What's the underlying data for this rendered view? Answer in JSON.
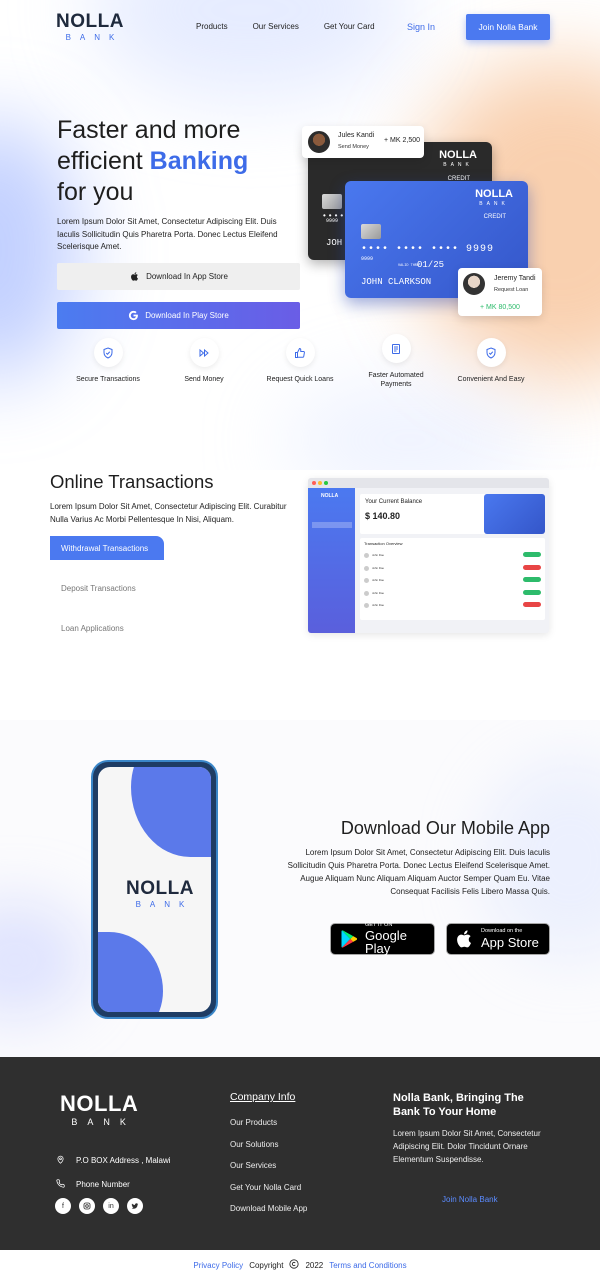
{
  "brand": {
    "name": "NOLLA",
    "sub": "BANK"
  },
  "nav": {
    "links": [
      "Products",
      "Our Services",
      "Get Your Card"
    ],
    "signin": "Sign In",
    "join": "Join Nolla Bank"
  },
  "hero": {
    "title_line1": "Faster and more",
    "title_line2_plain": "efficient ",
    "title_line2_accent": "Banking",
    "title_line3": "for you",
    "description": "Lorem Ipsum Dolor Sit Amet, Consectetur Adipiscing Elit. Duis Iaculis Sollicitudin Quis Pharetra Porta. Donec Lectus Eleifend Scelerisque Amet.",
    "app_store_btn": "Download In App Store",
    "play_store_btn": "Download In Play Store"
  },
  "cards": {
    "credit_label": "CREDIT",
    "blue": {
      "number": "••••  ••••  ••••  9999",
      "small_no": "9999",
      "valid": "VALID THRU",
      "expiry": "01/25",
      "holder": "JOHN  CLARKSON"
    },
    "dark": {
      "number": "••••",
      "small_no": "9999",
      "holder": "JOH"
    }
  },
  "notifications": [
    {
      "name": "Jules Kandi",
      "status": "Send Money",
      "amount": "+ MK 2,500"
    },
    {
      "name": "Jeremy Tandi",
      "status": "Request Loan",
      "amount": "+ MK 80,500"
    }
  ],
  "features": [
    {
      "label": "Secure Transactions",
      "icon": "shield-check-icon"
    },
    {
      "label": "Send Money",
      "icon": "fast-forward-icon"
    },
    {
      "label": "Request Quick Loans",
      "icon": "thumbs-up-icon"
    },
    {
      "label": "Faster Automated Payments",
      "icon": "receipt-icon"
    },
    {
      "label": "Convenient And Easy",
      "icon": "shield-check-icon"
    }
  ],
  "online": {
    "title": "Online Transactions",
    "description": "Lorem Ipsum Dolor Sit Amet, Consectetur Adipiscing Elit. Curabitur Nulla Varius Ac Morbi Pellentesque In Nisi, Aliquam.",
    "tabs": [
      "Withdrawal Transactions",
      "Deposit Transactions",
      "Loan Applications"
    ]
  },
  "dashboard": {
    "balance_label": "Your Current Balance",
    "balance_value": "$ 140.80",
    "table_title": "Transaction Overview",
    "rows": [
      {
        "name": "John Doe",
        "status_color": "#2dbb6b"
      },
      {
        "name": "John Doe",
        "status_color": "#e84545"
      },
      {
        "name": "John Doe",
        "status_color": "#2dbb6b"
      },
      {
        "name": "John Doe",
        "status_color": "#2dbb6b"
      },
      {
        "name": "John Doe",
        "status_color": "#e84545"
      }
    ]
  },
  "mobile": {
    "title": "Download Our Mobile App",
    "description": "Lorem Ipsum Dolor Sit Amet, Consectetur Adipiscing Elit. Duis Iaculis Sollicitudin Quis Pharetra Porta. Donec Lectus Eleifend Scelerisque Amet. Augue Aliquam Nunc Aliquam Aliquam Auctor Semper Quam Eu. Vitae Consequat Facilisis Felis Libero Massa Quis.",
    "google_small": "GET IT ON",
    "google_big": "Google Play",
    "apple_small": "Download on the",
    "apple_big": "App Store"
  },
  "footer": {
    "address": "P.O BOX Address , Malawi",
    "phone": "Phone Number",
    "company_heading": "Company Info",
    "links": [
      "Our Products",
      "Our Solutions",
      "Our Services",
      "Get Your Nolla Card",
      "Download Mobile App"
    ],
    "tagline": "Nolla Bank, Bringing The Bank To Your Home",
    "tagline_desc": "Lorem Ipsum Dolor Sit Amet, Consectetur Adipiscing Elit. Dolor Tincidunt Ornare Elementum Suspendisse.",
    "join": "Join Nolla Bank"
  },
  "bottom": {
    "privacy": "Privacy Policy",
    "copyright": "Copyright",
    "year": "2022",
    "terms": "Terms and Conditions"
  },
  "colors": {
    "accent": "#3d6be8",
    "footer_bg": "#2f2f2f",
    "success": "#2dbb6b",
    "danger": "#e84545"
  }
}
